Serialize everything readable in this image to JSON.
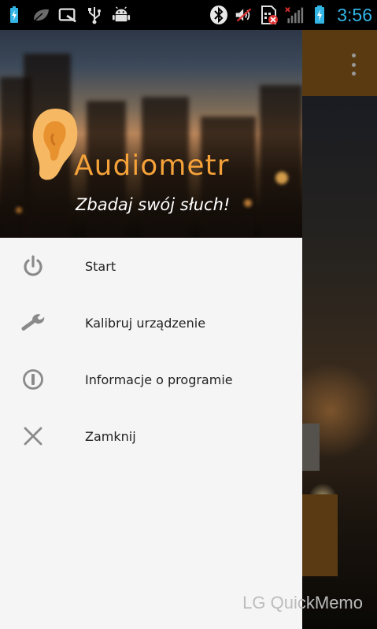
{
  "status_bar": {
    "time": "3:56",
    "icons": [
      "battery-charging-icon",
      "leaf-icon",
      "quickmemo-icon",
      "usb-icon",
      "android-debug-icon",
      "bluetooth-icon",
      "volume-muted-icon",
      "sim-error-icon",
      "signal-no-service-icon",
      "battery-charging-icon"
    ],
    "time_color": "#33b5e5"
  },
  "drawer": {
    "app_name": "Audiometr",
    "tagline": "Zbadaj swój słuch!",
    "brand_color": "#f5a23a",
    "items": [
      {
        "label": "Start",
        "icon": "power-icon"
      },
      {
        "label": "Kalibruj urządzenie",
        "icon": "wrench-icon"
      },
      {
        "label": "Informacje o programie",
        "icon": "info-icon"
      },
      {
        "label": "Zamknij",
        "icon": "close-icon"
      }
    ]
  },
  "background_app": {
    "overflow_menu_icon": "overflow-menu-icon"
  },
  "watermark": "LG QuickMemo"
}
